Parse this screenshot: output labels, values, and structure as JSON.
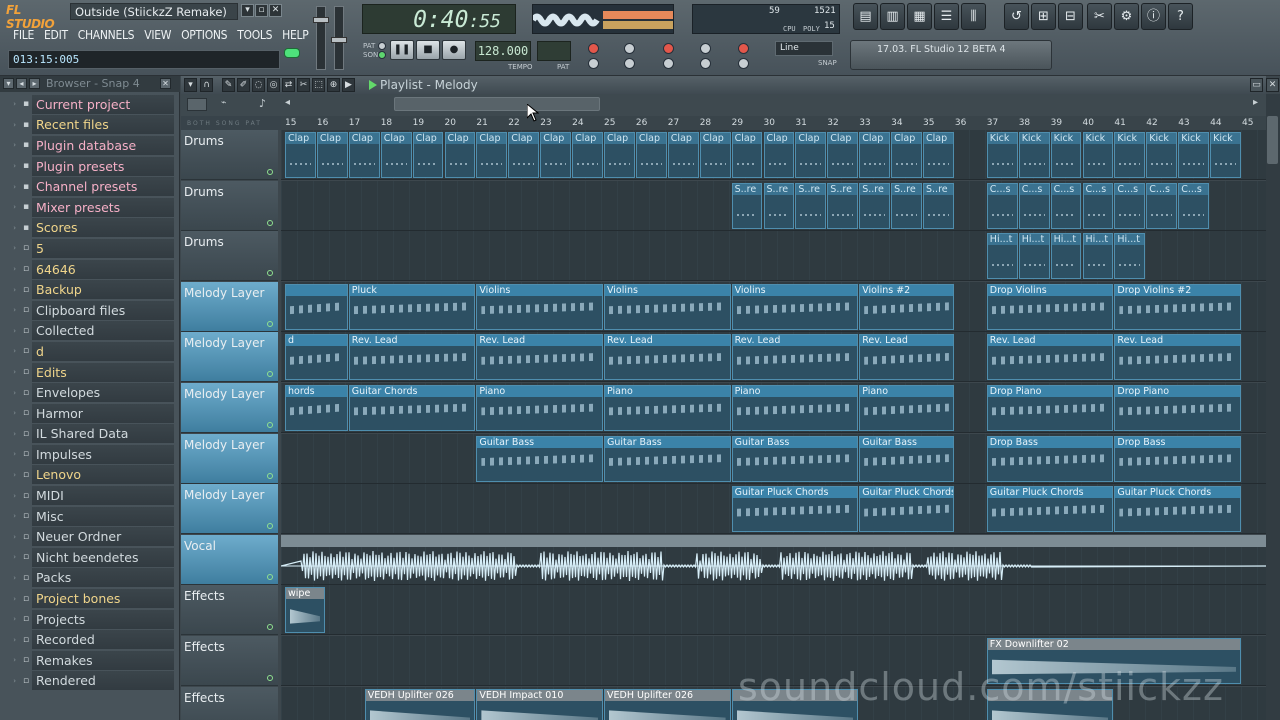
{
  "app": {
    "logo": "FL STUDIO",
    "window_title": "Outside (StiickzZ Remake)"
  },
  "menu": [
    "FILE",
    "EDIT",
    "CHANNELS",
    "VIEW",
    "OPTIONS",
    "TOOLS",
    "HELP"
  ],
  "hint_bar": "013:15:005",
  "transport": {
    "time": "0:40",
    "time_small": ":55",
    "tempo": "128.000",
    "tempo_label": "TEMPO",
    "pattern_label": "PAT",
    "pat_song": [
      "PAT",
      "SONG"
    ],
    "snap_label": "Line",
    "snap_sub": "SNAP"
  },
  "monitor": {
    "cpu": "59",
    "ram": "1521",
    "poly": "15",
    "labels": [
      "CPU",
      "POLY"
    ]
  },
  "news": "17.03. FL Studio 12 BETA 4",
  "browser": {
    "title": "Browser - Snap 4",
    "items": [
      {
        "label": "Current project",
        "type": "special"
      },
      {
        "label": "Recent files",
        "type": "sel"
      },
      {
        "label": "Plugin database",
        "type": "special"
      },
      {
        "label": "Plugin presets",
        "type": "special"
      },
      {
        "label": "Channel presets",
        "type": "special"
      },
      {
        "label": "Mixer presets",
        "type": "special"
      },
      {
        "label": "Scores",
        "type": "sel"
      },
      {
        "label": "5",
        "type": "sel"
      },
      {
        "label": "64646",
        "type": "sel"
      },
      {
        "label": "Backup",
        "type": "sel"
      },
      {
        "label": "Clipboard files",
        "type": "normal"
      },
      {
        "label": "Collected",
        "type": "normal"
      },
      {
        "label": "d",
        "type": "sel"
      },
      {
        "label": "Edits",
        "type": "sel"
      },
      {
        "label": "Envelopes",
        "type": "normal"
      },
      {
        "label": "Harmor",
        "type": "normal"
      },
      {
        "label": "IL Shared Data",
        "type": "normal"
      },
      {
        "label": "Impulses",
        "type": "normal"
      },
      {
        "label": "Lenovo",
        "type": "sel"
      },
      {
        "label": "MIDI",
        "type": "normal"
      },
      {
        "label": "Misc",
        "type": "normal"
      },
      {
        "label": "Neuer Ordner",
        "type": "normal"
      },
      {
        "label": "Nicht beendetes",
        "type": "normal"
      },
      {
        "label": "Packs",
        "type": "normal"
      },
      {
        "label": "Project bones",
        "type": "sel"
      },
      {
        "label": "Projects",
        "type": "normal"
      },
      {
        "label": "Recorded",
        "type": "normal"
      },
      {
        "label": "Remakes",
        "type": "normal"
      },
      {
        "label": "Rendered",
        "type": "normal"
      }
    ]
  },
  "playlist": {
    "title": "Playlist - Melody",
    "loop_labels": "BOTH SONG PAT",
    "bars": [
      "15",
      "16",
      "17",
      "18",
      "19",
      "20",
      "21",
      "22",
      "23",
      "24",
      "25",
      "26",
      "27",
      "28",
      "29",
      "30",
      "31",
      "32",
      "33",
      "34",
      "35",
      "36",
      "37",
      "38",
      "39",
      "40",
      "41",
      "42",
      "43",
      "44",
      "45"
    ],
    "tracks": [
      {
        "name": "Drums",
        "kind": "drum",
        "clips": [
          {
            "label": "Clap",
            "from": 15,
            "to": 36,
            "repeat": "Clap"
          },
          {
            "label": "Kick",
            "from": 37,
            "to": 45,
            "repeat": "Kick"
          }
        ]
      },
      {
        "name": "Drums",
        "kind": "drum",
        "clips": [
          {
            "label": "S..re",
            "from": 29,
            "to": 36,
            "repeat": "S..re"
          },
          {
            "label": "C...s",
            "from": 37,
            "to": 44,
            "repeat": "C...s"
          }
        ]
      },
      {
        "name": "Drums",
        "kind": "drum",
        "clips": [
          {
            "label": "Hi...t",
            "from": 37,
            "to": 42,
            "repeat": "Hi...t"
          }
        ]
      },
      {
        "name": "Melody Layer",
        "kind": "mel",
        "clips": [
          {
            "label": "",
            "from": 15,
            "to": 17
          },
          {
            "label": "Pluck",
            "from": 17,
            "to": 21
          },
          {
            "label": "Violins",
            "from": 21,
            "to": 25
          },
          {
            "label": "Violins",
            "from": 25,
            "to": 29
          },
          {
            "label": "Violins",
            "from": 29,
            "to": 33
          },
          {
            "label": "Violins #2",
            "from": 33,
            "to": 36
          },
          {
            "label": "Drop Violins",
            "from": 37,
            "to": 41
          },
          {
            "label": "Drop Violins #2",
            "from": 41,
            "to": 45
          }
        ]
      },
      {
        "name": "Melody Layer",
        "kind": "mel",
        "clips": [
          {
            "label": "d",
            "from": 15,
            "to": 17
          },
          {
            "label": "Rev. Lead",
            "from": 17,
            "to": 21
          },
          {
            "label": "Rev. Lead",
            "from": 21,
            "to": 25
          },
          {
            "label": "Rev. Lead",
            "from": 25,
            "to": 29
          },
          {
            "label": "Rev. Lead",
            "from": 29,
            "to": 33
          },
          {
            "label": "Rev. Lead",
            "from": 33,
            "to": 36
          },
          {
            "label": "Rev. Lead",
            "from": 37,
            "to": 41
          },
          {
            "label": "Rev. Lead",
            "from": 41,
            "to": 45
          }
        ]
      },
      {
        "name": "Melody Layer",
        "kind": "mel",
        "clips": [
          {
            "label": "hords",
            "from": 15,
            "to": 17
          },
          {
            "label": "Guitar Chords",
            "from": 17,
            "to": 21
          },
          {
            "label": "Piano",
            "from": 21,
            "to": 25
          },
          {
            "label": "Piano",
            "from": 25,
            "to": 29
          },
          {
            "label": "Piano",
            "from": 29,
            "to": 33
          },
          {
            "label": "Piano",
            "from": 33,
            "to": 36
          },
          {
            "label": "Drop Piano",
            "from": 37,
            "to": 41
          },
          {
            "label": "Drop Piano",
            "from": 41,
            "to": 45
          }
        ]
      },
      {
        "name": "Melody Layer",
        "kind": "mel",
        "clips": [
          {
            "label": "Guitar Bass",
            "from": 21,
            "to": 25
          },
          {
            "label": "Guitar Bass",
            "from": 25,
            "to": 29
          },
          {
            "label": "Guitar Bass",
            "from": 29,
            "to": 33
          },
          {
            "label": "Guitar Bass",
            "from": 33,
            "to": 36
          },
          {
            "label": "Drop Bass",
            "from": 37,
            "to": 41
          },
          {
            "label": "Drop Bass",
            "from": 41,
            "to": 45
          }
        ]
      },
      {
        "name": "Melody Layer",
        "kind": "mel",
        "clips": [
          {
            "label": "Guitar Pluck Chords",
            "from": 29,
            "to": 33
          },
          {
            "label": "Guitar Pluck Chords",
            "from": 33,
            "to": 36
          },
          {
            "label": "Guitar Pluck Chords",
            "from": 37,
            "to": 41
          },
          {
            "label": "Guitar Pluck Chords",
            "from": 41,
            "to": 45
          }
        ]
      },
      {
        "name": "Vocal",
        "kind": "voc",
        "clips": []
      },
      {
        "name": "Effects",
        "kind": "fx",
        "clips": [
          {
            "label": "wipe",
            "from": 15,
            "to": 16.3
          }
        ]
      },
      {
        "name": "Effects",
        "kind": "fx",
        "clips": [
          {
            "label": "FX Downlifter 02",
            "from": 37,
            "to": 45
          }
        ]
      },
      {
        "name": "Effects",
        "kind": "fx",
        "clips": [
          {
            "label": "VEDH Uplifter 026",
            "from": 17.5,
            "to": 21
          },
          {
            "label": "VEDH Impact 010",
            "from": 21,
            "to": 25
          },
          {
            "label": "VEDH Uplifter 026",
            "from": 25,
            "to": 29
          },
          {
            "label": "",
            "from": 29,
            "to": 33
          },
          {
            "label": "",
            "from": 37,
            "to": 41
          }
        ]
      }
    ]
  },
  "watermark": "soundcloud.com/stiickzz",
  "colors": {
    "clip": "#3b83a9",
    "clip_fx": "#7b858b",
    "accent": "#f2a23a",
    "track_head": "#6eaccc"
  },
  "icons": [
    "play-icon",
    "stop-icon",
    "record-icon",
    "undo-icon",
    "save-icon",
    "mixer-icon",
    "piano-roll-icon",
    "browser-icon",
    "help-icon"
  ]
}
